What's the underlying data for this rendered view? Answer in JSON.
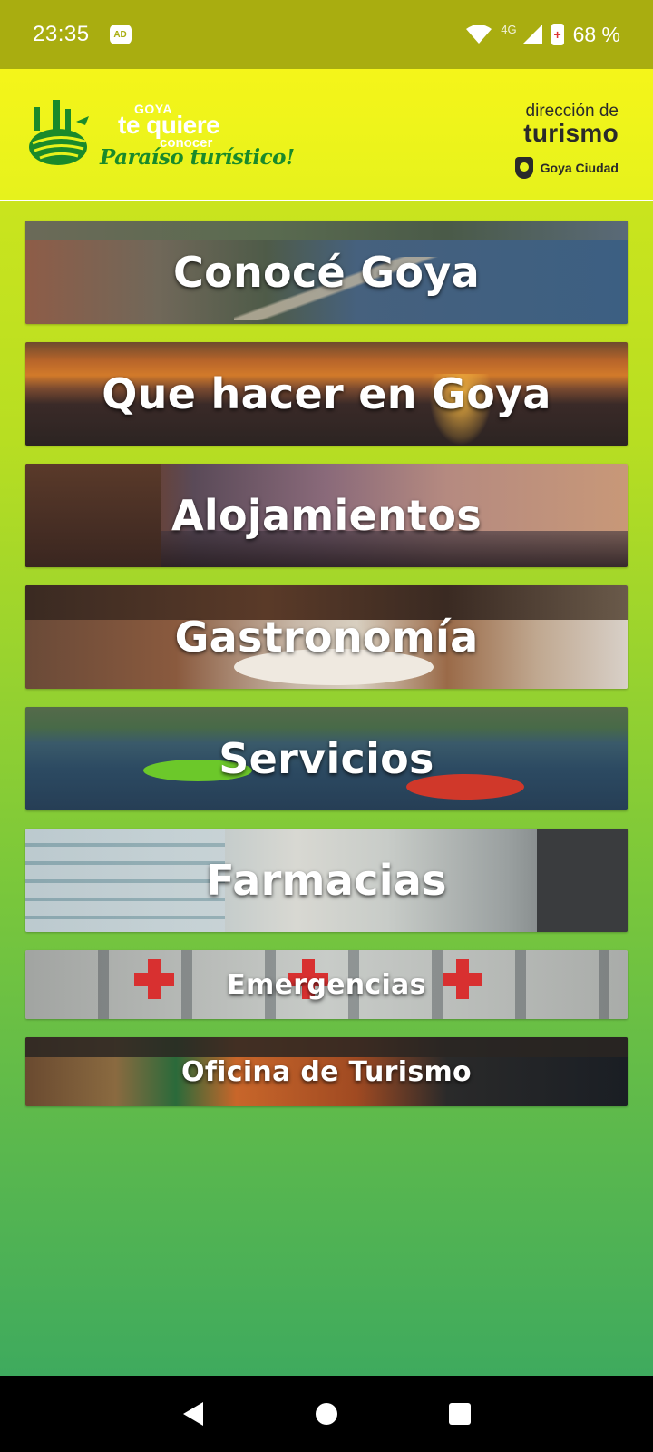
{
  "status_bar": {
    "time": "23:35",
    "adblock_badge": "AD",
    "network_type": "4G",
    "battery_percent": "68 %"
  },
  "header": {
    "logo": {
      "goya": "GOYA",
      "te_quiere": "te quiere",
      "conocer": "conocer",
      "tagline": "Paraíso turístico!"
    },
    "direccion": {
      "line1": "dirección de",
      "line2": "turismo",
      "city": "Goya Ciudad"
    }
  },
  "menu": {
    "items": [
      {
        "label": "Conocé Goya"
      },
      {
        "label": "Que hacer en Goya"
      },
      {
        "label": "Alojamientos"
      },
      {
        "label": "Gastronomía"
      },
      {
        "label": "Servicios"
      },
      {
        "label": "Farmacias"
      },
      {
        "label": "Emergencias"
      },
      {
        "label": "Oficina de Turismo"
      }
    ]
  },
  "colors": {
    "header_bg": "#e6f21c",
    "status_bar_bg": "#a9ad10",
    "brand_green": "#1a8a2a"
  },
  "nav_bar": {
    "back_icon": "back-triangle-icon",
    "home_icon": "home-circle-icon",
    "recents_icon": "recents-square-icon"
  }
}
